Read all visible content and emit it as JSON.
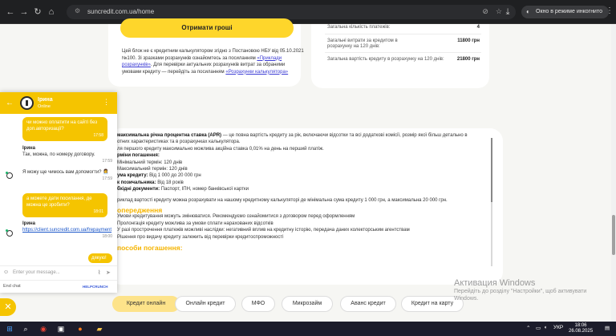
{
  "browser": {
    "url": "suncredit.com.ua/home",
    "incognito_label": "Окно в режиме инкогнито"
  },
  "top_left_card": {
    "button_label": "Отримати гроші",
    "note_part1": "Цей блок не є кредитним калькулятором згідно з Постановою НБУ від 05.10.2021 №100. Зі зразками розрахунків ознайомтесь за посиланням",
    "note_link1": "«Приклади розрахунків»",
    "note_part2": ". Для перевірки актуальних розрахунків витрат за обраними умовами кредиту — перейдіть за посиланням",
    "note_link2": "«Розрахунки калькулятора»"
  },
  "stats": [
    {
      "label": "Загальна кількість платежів:",
      "value": "4"
    },
    {
      "label": "Загальні витрати за кредитом в розрахунку на 120 днів:",
      "value": "11800 грн"
    },
    {
      "label": "Загальна вартість кредиту в розрахунку на 120 днів:",
      "value": "21800 грн"
    }
  ],
  "content": {
    "line1_bold": "максимальна річна процентна ставка (APR)",
    "line1_rest": " — це повна вартість кредиту за рік, включаючи відсотки та всі додаткові комісії, розмір якої більш детально в",
    "line2": "отних характеристиках та в розрахунках калькулятора.",
    "line3": "ля першого кредиту максимально можлива акційна ставка 0,01% на день на перший платіж.",
    "terms_head": "рміни погашення:",
    "term_min": "Мінімальний термін: 120 днів",
    "term_max": "Максимальний термін: 120 днів",
    "sum_bold": "ума кредиту:",
    "sum_rest": " Від 1 000 до 20 000 грн",
    "age_bold": "к позичальника:",
    "age_rest": " Від 18 років",
    "docs_bold": "бхідні документи:",
    "docs_rest": " Паспорт, ІПН, номер банківської картки",
    "example": "риклад вартості кредиту можна розрахувати на нашому кредитному калькуляторі де мінімальна сума кредиту 1 000 грн, а максимальна 20 000 грн.",
    "warn_head": "опередження",
    "warn1": "Умови кредитування можуть змінюватися. Рекомендуємо ознайомитися з договором перед оформленням",
    "warn2": "Пролонгація кредиту можлива за умови сплати нарахованих відсотків",
    "warn3": "У разі прострочення платежів можливі наслідки: негативний вплив на кредитну історію, передача даних колекторським агентствам",
    "warn4": "Рішення про видачу кредиту залежить від перевірки кредитоспроможності",
    "pay_head": "пособи погашення:"
  },
  "pills": [
    "Кредит онлайн",
    "Онлайн кредит",
    "МФО",
    "Микрозайм",
    "Аванс кредит",
    "Кредит на карту"
  ],
  "watermark": {
    "title": "Активация Windows",
    "line1": "Перейдіть до розділу \"Настройки\", щоб активувати",
    "line2": "Windows."
  },
  "chat": {
    "name": "Ірина",
    "status": "Online",
    "msg1": "чи можно оплатити на сайті без доп.авторизації?",
    "msg1_time": "17:58",
    "agent1_name": "Ірина",
    "agent1_text": "Так, можна, по номеру договору.",
    "agent1_time": "17:59",
    "agent2_text": "Я можу ще чимось вам допомогти? 👩‍💼",
    "agent2_time": "17:59",
    "msg2": "а можете дати посилання, де можна це зробити?",
    "msg2_time": "18:01",
    "agent3_name": "Ірина",
    "agent3_link": "https://client.suncredit.com.ua/frepayment",
    "agent3_time": "18:00",
    "msg3": "дякую!",
    "input_placeholder": "Enter your message...",
    "end_chat": "End chat",
    "powered": "HELPCRUNCH"
  },
  "taskbar": {
    "lang": "УКР",
    "time": "18:06",
    "date": "26.08.2025"
  }
}
